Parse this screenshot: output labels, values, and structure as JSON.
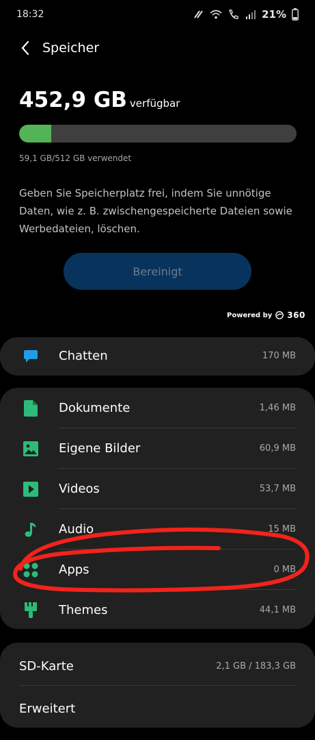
{
  "status_bar": {
    "time": "18:32",
    "battery": "21%"
  },
  "header": {
    "title": "Speicher"
  },
  "storage": {
    "available_value": "452,9 GB",
    "available_label": "verfügbar",
    "used_text": "59,1 GB/512 GB verwendet",
    "used_fraction": 0.115,
    "description": "Geben Sie Speicherplatz frei, indem Sie unnötige Daten, wie z. B. zwischengespeicherte Dateien sowie Werbedateien, löschen.",
    "clean_button": "Bereinigt",
    "powered_by": "Powered by",
    "powered_brand": "360"
  },
  "chat": {
    "label": "Chatten",
    "size": "170 MB",
    "icon": "chat-icon",
    "color": "#1e9ee6"
  },
  "categories": [
    {
      "label": "Dokumente",
      "size": "1,46 MB",
      "icon": "document-icon"
    },
    {
      "label": "Eigene Bilder",
      "size": "60,9 MB",
      "icon": "image-icon"
    },
    {
      "label": "Videos",
      "size": "53,7 MB",
      "icon": "video-icon"
    },
    {
      "label": "Audio",
      "size": "15 MB",
      "icon": "music-note-icon"
    },
    {
      "label": "Apps",
      "size": "0 MB",
      "icon": "apps-icon"
    },
    {
      "label": "Themes",
      "size": "44,1 MB",
      "icon": "paint-brush-icon"
    }
  ],
  "category_color": "#2dbb7b",
  "sd_card": {
    "label": "SD-Karte",
    "size": "2,1 GB / 183,3 GB"
  },
  "advanced": {
    "label": "Erweitert"
  },
  "colors": {
    "background": "#000000",
    "card": "#212121",
    "usage_fill": "#53b457",
    "button": "#08335d",
    "annotation": "#f2231c"
  }
}
